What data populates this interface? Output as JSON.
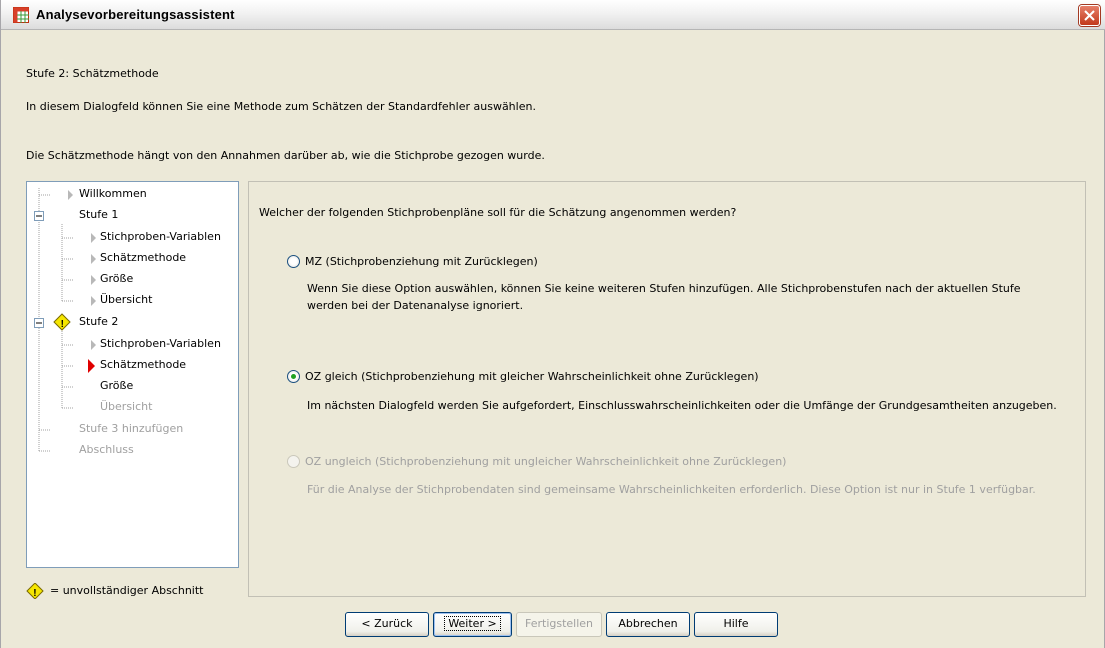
{
  "window": {
    "title": "Analysevorbereitungsassistent",
    "step_title": "Stufe 2: Schätzmethode",
    "intro_line1": "In diesem Dialogfeld können Sie eine Methode zum Schätzen der Standardfehler auswählen.",
    "intro_line2": "Die Schätzmethode hängt von den Annahmen darüber ab, wie die Stichprobe gezogen wurde."
  },
  "nav": {
    "items": [
      {
        "label": "Willkommen"
      },
      {
        "label": "Stufe 1"
      },
      {
        "label": "Stichproben-Variablen"
      },
      {
        "label": "Schätzmethode"
      },
      {
        "label": "Größe"
      },
      {
        "label": "Übersicht"
      },
      {
        "label": "Stufe 2"
      },
      {
        "label": "Stichproben-Variablen"
      },
      {
        "label": "Schätzmethode"
      },
      {
        "label": "Größe"
      },
      {
        "label": "Übersicht"
      },
      {
        "label": "Stufe 3 hinzufügen"
      },
      {
        "label": "Abschluss"
      }
    ],
    "legend": "= unvollständiger Abschnitt"
  },
  "content": {
    "question": "Welcher der folgenden Stichprobenpläne soll für die Schätzung angenommen werden?",
    "options": [
      {
        "label": "MZ (Stichprobenziehung mit Zurücklegen)",
        "desc1": "Wenn Sie diese Option auswählen, können Sie keine weiteren Stufen hinzufügen. Alle Stichprobenstufen nach der aktuellen Stufe",
        "desc2": "werden bei der Datenanalyse ignoriert.",
        "checked": false,
        "enabled": true
      },
      {
        "label": "OZ gleich (Stichprobenziehung mit gleicher Wahrscheinlichkeit ohne Zurücklegen)",
        "desc1": "Im nächsten Dialogfeld werden Sie aufgefordert, Einschlusswahrscheinlichkeiten oder die Umfänge der Grundgesamtheiten anzugeben.",
        "checked": true,
        "enabled": true
      },
      {
        "label": "OZ ungleich (Stichprobenziehung mit ungleicher Wahrscheinlichkeit ohne Zurücklegen)",
        "desc1": "Für die Analyse der Stichprobendaten sind gemeinsame Wahrscheinlichkeiten erforderlich. Diese Option ist nur in Stufe 1 verfügbar.",
        "checked": false,
        "enabled": false
      }
    ]
  },
  "buttons": {
    "back": "< Zurück",
    "next": "Weiter >",
    "finish": "Fertigstellen",
    "cancel": "Abbrechen",
    "help": "Hilfe"
  },
  "colors": {
    "warning": "#f5e600",
    "current_marker": "#e00000",
    "radio_selected": "#21a121"
  }
}
